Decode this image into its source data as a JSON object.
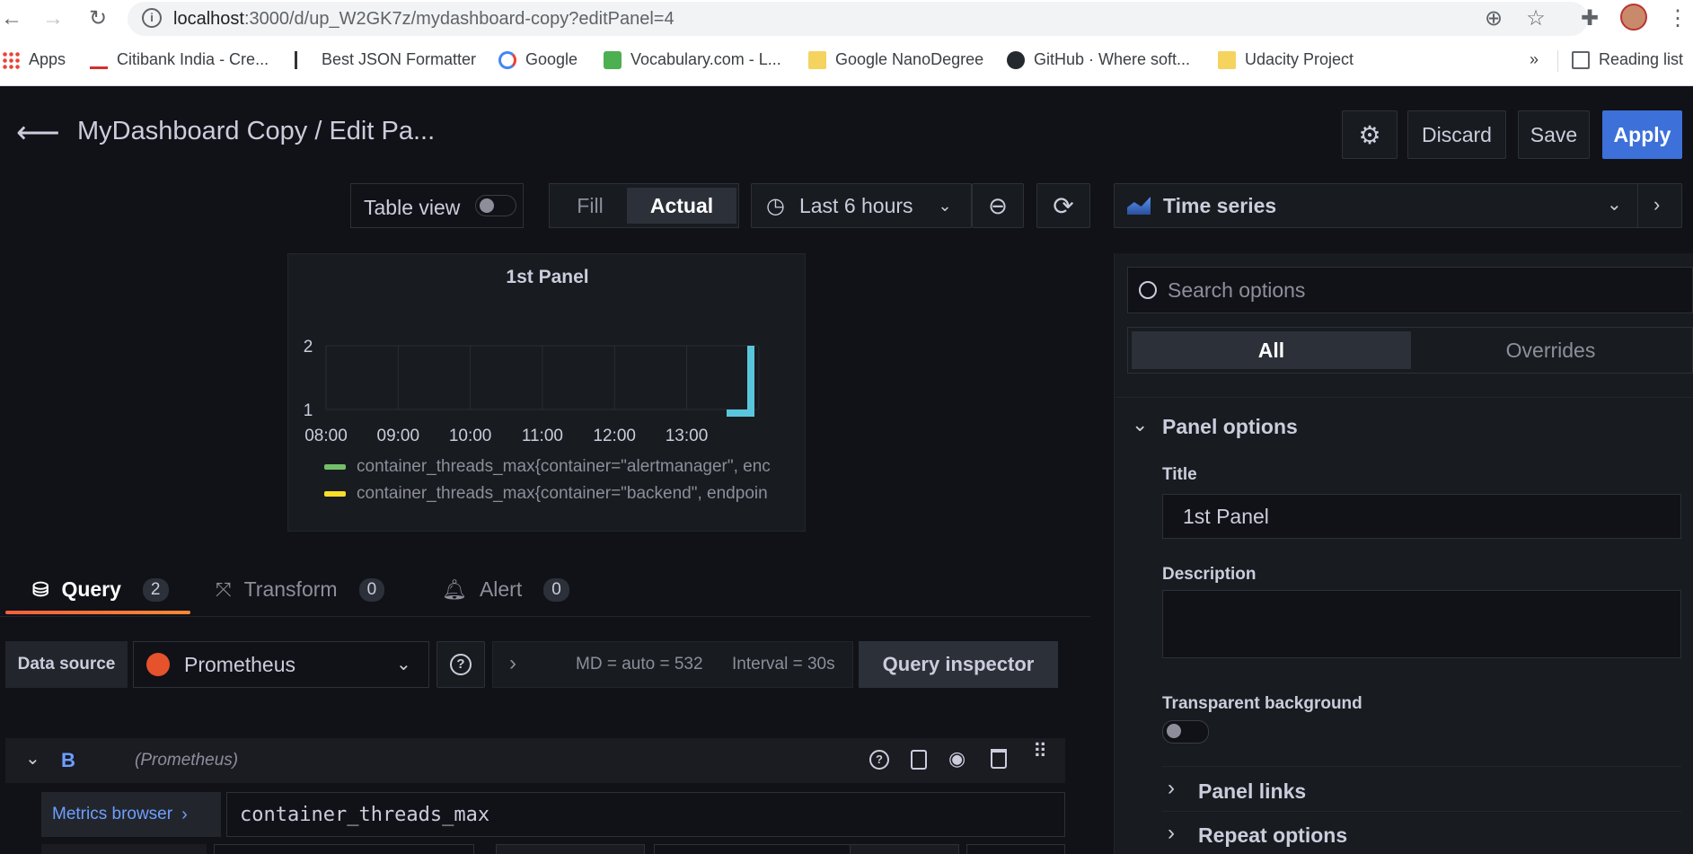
{
  "browser": {
    "url_host": "localhost",
    "url_path": ":3000/d/up_W2GK7z/mydashboard-copy?editPanel=4",
    "bookmarks": [
      {
        "label": "Apps",
        "icon": "apps-grid-icon"
      },
      {
        "label": "Citibank India - Cre...",
        "icon": "citi-icon"
      },
      {
        "label": "Best JSON Formatter",
        "icon": "jf-icon"
      },
      {
        "label": "Google",
        "icon": "google-icon"
      },
      {
        "label": "Vocabulary.com - L...",
        "icon": "vocabulary-icon"
      },
      {
        "label": "Google NanoDegree",
        "icon": "folder-icon"
      },
      {
        "label": "GitHub · Where soft...",
        "icon": "github-icon"
      },
      {
        "label": "Udacity Project",
        "icon": "folder-icon"
      }
    ],
    "overflow": "»",
    "reading_list": "Reading list"
  },
  "header": {
    "title": "MyDashboard Copy / Edit Pa...",
    "discard": "Discard",
    "save": "Save",
    "apply": "Apply"
  },
  "toolbar": {
    "table_view": "Table view",
    "fill": "Fill",
    "actual": "Actual",
    "time_range": "Last 6 hours"
  },
  "visualization": {
    "selected": "Time series"
  },
  "chart_data": {
    "type": "line",
    "title": "1st Panel",
    "x": [
      "08:00",
      "09:00",
      "10:00",
      "11:00",
      "12:00",
      "13:00"
    ],
    "y_ticks": [
      1,
      2
    ],
    "ylim": [
      1,
      2
    ],
    "series": [
      {
        "name": "container_threads_max{container=\"alertmanager\", enc",
        "color": "#73bf69"
      },
      {
        "name": "container_threads_max{container=\"backend\", endpoin",
        "color": "#fade2a"
      }
    ],
    "visible_segment": {
      "color": "#5ac6dd",
      "from": "13:45",
      "to": "13:55",
      "low": 1,
      "high": 2
    }
  },
  "query_tabs": [
    {
      "label": "Query",
      "count": "2",
      "icon": "database-icon",
      "active": true
    },
    {
      "label": "Transform",
      "count": "0",
      "icon": "transform-icon",
      "active": false
    },
    {
      "label": "Alert",
      "count": "0",
      "icon": "bell-icon",
      "active": false
    }
  ],
  "query_row": {
    "data_source_label": "Data source",
    "data_source": "Prometheus",
    "md": "MD = auto = 532",
    "interval": "Interval = 30s",
    "inspector": "Query inspector"
  },
  "query_b": {
    "ref": "B",
    "source": "(Prometheus)",
    "metrics_browser": "Metrics browser",
    "expr": "container_threads_max"
  },
  "options": {
    "search_placeholder": "Search options",
    "tab_all": "All",
    "tab_overrides": "Overrides",
    "section_panel": "Panel options",
    "title_label": "Title",
    "title_value": "1st Panel",
    "description_label": "Description",
    "transparent_label": "Transparent background",
    "panel_links": "Panel links",
    "repeat_options": "Repeat options"
  }
}
